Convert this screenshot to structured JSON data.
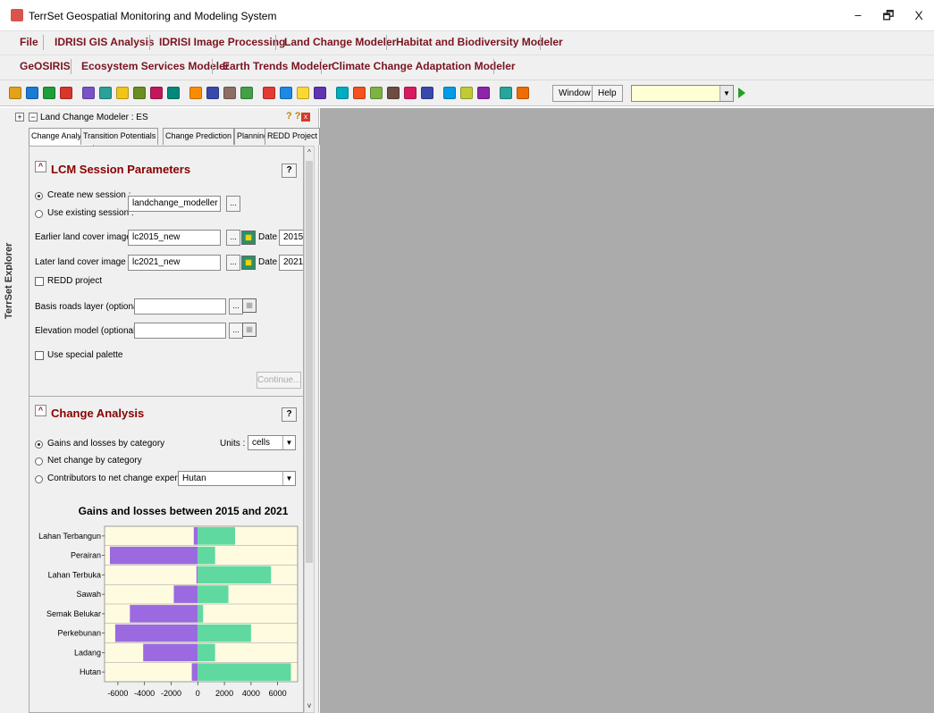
{
  "window": {
    "title": "TerrSet Geospatial Monitoring and Modeling System",
    "controls": {
      "minimize": "−",
      "maximize": "🗗",
      "close": "X"
    }
  },
  "menu_row1": [
    "File",
    "IDRISI GIS Analysis",
    "IDRISI Image Processing",
    "Land Change Modeler",
    "Habitat and Biodiversity Modeler"
  ],
  "menu_row2": [
    "GeOSIRIS",
    "Ecosystem Services Modeler",
    "Earth Trends Modeler",
    "Climate Change Adaptation Modeler"
  ],
  "toolbar": {
    "window_label": "Window",
    "help_label": "Help",
    "combo_value": "",
    "icon_colors": [
      "#e3a21a",
      "#1a7bd6",
      "#1e9e3a",
      "#d9352b",
      "#7a52c7",
      "#2aa198",
      "#f0c419",
      "#6b8e23",
      "#c2185b",
      "#00897b",
      "#fb8c00",
      "#3949ab",
      "#8d6e63",
      "#43a047",
      "#e53935",
      "#1e88e5",
      "#fdd835",
      "#5e35b1",
      "#00acc1",
      "#f4511e",
      "#7cb342",
      "#6d4c41",
      "#d81b60",
      "#3949ab",
      "#039be5",
      "#c0ca33",
      "#8e24aa",
      "#26a69a",
      "#ef6c00"
    ]
  },
  "explorer_tab": "TerrSet Explorer",
  "panel": {
    "title": "Land Change Modeler : ES",
    "help": "? ?",
    "tabs": [
      "Change Analysis",
      "Transition Potentials",
      "Change Prediction",
      "Planning",
      "REDD Project"
    ]
  },
  "session": {
    "title": "LCM Session Parameters",
    "help": "?",
    "create_new_label": "Create new session :",
    "use_existing_label": "Use existing session :",
    "session_name": "landchange_modeller",
    "earlier_label": "Earlier land cover image :",
    "earlier_value": "lc2015_new",
    "earlier_date_label": "Date :",
    "earlier_date": "2015",
    "later_label": "Later land cover image :",
    "later_value": "lc2021_new",
    "later_date_label": "Date :",
    "later_date": "2021",
    "redd_label": "REDD project",
    "roads_label": "Basis roads layer (optional) :",
    "roads_value": "",
    "elevation_label": "Elevation model (optional) :",
    "elevation_value": "",
    "palette_label": "Use special palette",
    "continue_label": "Continue...",
    "dots": "..."
  },
  "change": {
    "title": "Change Analysis",
    "help": "?",
    "opt1": "Gains and losses by category",
    "opt2": "Net change by category",
    "opt3": "Contributors to net change experienced by :",
    "units_label": "Units :",
    "units_value": "cells",
    "contributor_value": "Hutan"
  },
  "colors": {
    "loss": "#9b6ae0",
    "gain": "#5fd9a0",
    "chart_bg": "#fffbe0",
    "map_bg": "#ababab",
    "menu_text": "#7a1420"
  },
  "chart_data": {
    "type": "bar",
    "title": "Gains and losses between 2015 and 2021",
    "categories": [
      "Lahan Terbangun",
      "Perairan",
      "Lahan Terbuka",
      "Sawah",
      "Semak Belukar",
      "Perkebunan",
      "Ladang",
      "Hutan"
    ],
    "series": [
      {
        "values": [
          -300,
          -6600,
          -100,
          -1800,
          -5100,
          -6200,
          -4100,
          -450
        ]
      },
      {
        "values": [
          2800,
          1300,
          5500,
          2300,
          400,
          4000,
          1300,
          7000
        ]
      }
    ],
    "xlim": [
      -7000,
      7500
    ],
    "xticks": [
      -6000,
      -4000,
      -2000,
      0,
      2000,
      4000,
      6000
    ],
    "grid": true
  }
}
